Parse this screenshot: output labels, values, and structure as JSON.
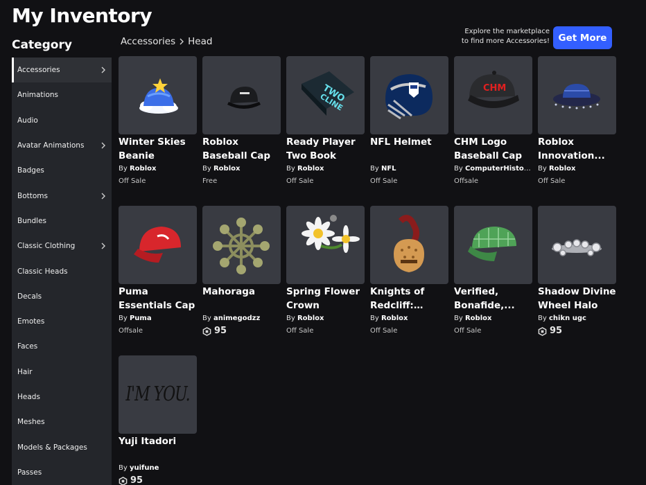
{
  "page": {
    "title": "My Inventory"
  },
  "sidebar": {
    "heading": "Category",
    "items": [
      {
        "label": "Accessories",
        "chevron": true,
        "active": true
      },
      {
        "label": "Animations",
        "chevron": false
      },
      {
        "label": "Audio",
        "chevron": false
      },
      {
        "label": "Avatar Animations",
        "chevron": true
      },
      {
        "label": "Badges",
        "chevron": false
      },
      {
        "label": "Bottoms",
        "chevron": true
      },
      {
        "label": "Bundles",
        "chevron": false
      },
      {
        "label": "Classic Clothing",
        "chevron": true
      },
      {
        "label": "Classic Heads",
        "chevron": false
      },
      {
        "label": "Decals",
        "chevron": false
      },
      {
        "label": "Emotes",
        "chevron": false
      },
      {
        "label": "Faces",
        "chevron": false
      },
      {
        "label": "Hair",
        "chevron": false
      },
      {
        "label": "Heads",
        "chevron": false
      },
      {
        "label": "Meshes",
        "chevron": false
      },
      {
        "label": "Models & Packages",
        "chevron": false
      },
      {
        "label": "Passes",
        "chevron": false
      }
    ]
  },
  "breadcrumb": {
    "parent": "Accessories",
    "current": "Head"
  },
  "promo": {
    "line1": "Explore the marketplace",
    "line2": "to find more Accessories!",
    "button": "Get More"
  },
  "by_prefix": "By",
  "items": [
    {
      "name": "Winter Skies Beanie",
      "creator": "Roblox",
      "price": "Off Sale",
      "icon": "winter-beanie-icon"
    },
    {
      "name": "Roblox Baseball Cap",
      "creator": "Roblox",
      "price": "Free",
      "icon": "baseball-cap-icon"
    },
    {
      "name": "Ready Player Two Book",
      "creator": "Roblox",
      "price": "Off Sale",
      "icon": "book-icon"
    },
    {
      "name": "NFL Helmet",
      "creator": "NFL",
      "price": "Off Sale",
      "icon": "football-helmet-icon"
    },
    {
      "name": "CHM Logo Baseball Cap",
      "creator": "ComputerHistory...",
      "price": "Offsale",
      "icon": "chm-cap-icon"
    },
    {
      "name": "Roblox Innovation...",
      "creator": "Roblox",
      "price": "Off Sale",
      "icon": "innovation-hat-icon"
    },
    {
      "name": "Puma Essentials Cap",
      "creator": "Puma",
      "price": "Offsale",
      "icon": "puma-cap-icon"
    },
    {
      "name": "Mahoraga",
      "creator": "animegodzz",
      "price": "95",
      "robux": true,
      "icon": "wheel-icon"
    },
    {
      "name": "Spring Flower Crown",
      "creator": "Roblox",
      "price": "Off Sale",
      "icon": "flower-crown-icon"
    },
    {
      "name": "Knights of Redcliff: Paladi...",
      "creator": "Roblox",
      "price": "Off Sale",
      "icon": "knight-helmet-icon"
    },
    {
      "name": "Verified, Bonafide,...",
      "creator": "Roblox",
      "price": "Off Sale",
      "icon": "plaid-cap-icon"
    },
    {
      "name": "Shadow Divine Wheel Halo",
      "creator": "chikn ugc",
      "price": "95",
      "robux": true,
      "icon": "halo-icon"
    },
    {
      "name": "Yuji Itadori",
      "creator": "yuifune",
      "price": "95",
      "robux": true,
      "icon": "im-you-text-icon",
      "thumb_text": "I'M YOU."
    }
  ],
  "colors": {
    "background": "#111114",
    "sidebar": "#24262b",
    "card": "#393b42",
    "accent": "#335fff"
  }
}
